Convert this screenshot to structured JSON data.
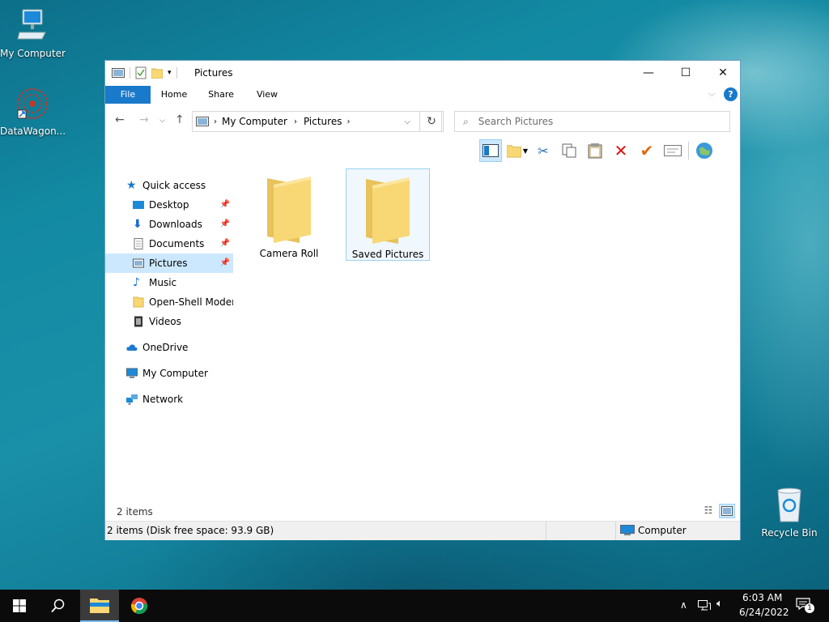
{
  "desktop": {
    "icons": [
      {
        "label": "My Computer"
      },
      {
        "label": "DataWagon..."
      },
      {
        "label": "Recycle Bin"
      }
    ]
  },
  "window": {
    "title": "Pictures",
    "ribbon_tabs": [
      "File",
      "Home",
      "Share",
      "View"
    ],
    "breadcrumb": [
      "My Computer",
      "Pictures"
    ],
    "search_placeholder": "Search Pictures",
    "nav": {
      "quick_access": "Quick access",
      "pinned": [
        "Desktop",
        "Downloads",
        "Documents",
        "Pictures"
      ],
      "unpinned": [
        "Music",
        "Open-Shell Modern",
        "Videos"
      ],
      "onedrive": "OneDrive",
      "my_computer": "My Computer",
      "network": "Network",
      "selected": "Pictures"
    },
    "items": [
      {
        "name": "Camera Roll",
        "selected": false
      },
      {
        "name": "Saved Pictures",
        "selected": true
      }
    ],
    "item_count": "2 items",
    "status_left": "2 items (Disk free space: 93.9 GB)",
    "status_right": "Computer"
  },
  "taskbar": {
    "time": "6:03 AM",
    "date": "6/24/2022",
    "notification_count": "1"
  },
  "colors": {
    "accent": "#1979ca",
    "selection": "#cce8ff",
    "folder": "#f8d775"
  }
}
